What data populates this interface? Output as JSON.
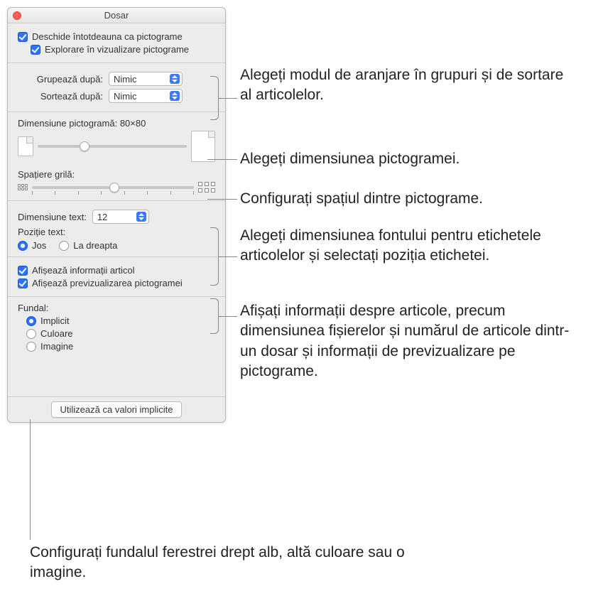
{
  "window": {
    "title": "Dosar"
  },
  "top": {
    "always_icons": "Deschide întotdeauna ca pictograme",
    "browse_icons": "Explorare în vizualizare pictograme"
  },
  "sort": {
    "group_label": "Grupează după:",
    "group_value": "Nimic",
    "sort_label": "Sortează după:",
    "sort_value": "Nimic"
  },
  "icon": {
    "size_label": "Dimensiune pictogramă:",
    "size_value": "80×80",
    "spacing_label": "Spațiere grilă:"
  },
  "text": {
    "size_label": "Dimensiune text:",
    "size_value": "12",
    "pos_label": "Poziție text:",
    "pos_below": "Jos",
    "pos_right": "La dreapta"
  },
  "info": {
    "show_item_info": "Afișează informații articol",
    "show_icon_preview": "Afișează previzualizarea pictogramei"
  },
  "background": {
    "heading": "Fundal:",
    "default": "Implicit",
    "color": "Culoare",
    "image": "Imagine"
  },
  "button": {
    "defaults": "Utilizează ca valori implicite"
  },
  "annotations": {
    "a1": "Alegeți modul de aranjare în grupuri și de sortare al articolelor.",
    "a2": "Alegeți dimensiunea pictogramei.",
    "a3": "Configurați spațiul dintre pictograme.",
    "a4": "Alegeți dimensiunea fontului pentru etichetele articolelor și selectați poziția etichetei.",
    "a5": "Afișați informații despre articole, precum dimensiunea fișierelor și numărul de articole dintr-un dosar și informații de previzualizare pe pictograme.",
    "a6": "Configurați fundalul ferestrei drept alb, altă culoare sau o imagine."
  }
}
